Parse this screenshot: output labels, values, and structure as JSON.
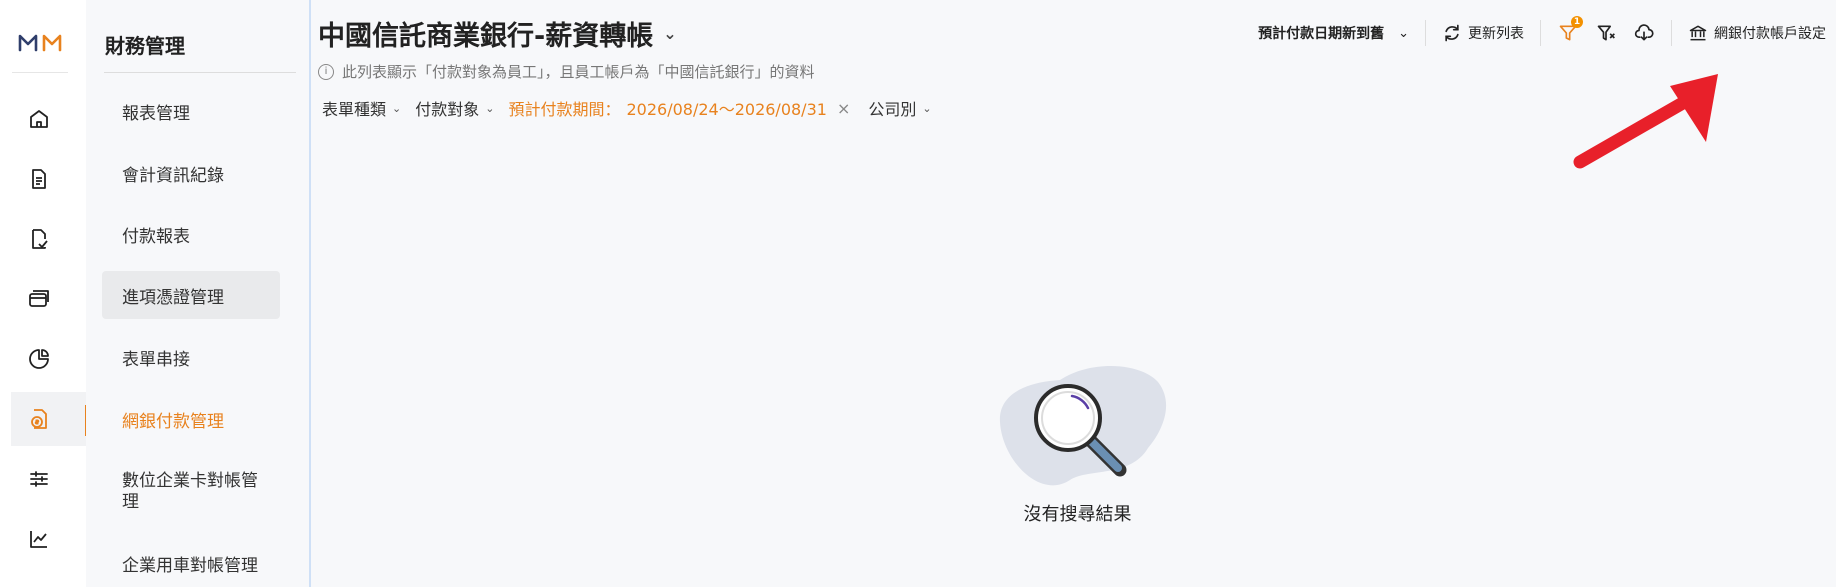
{
  "rail": {
    "items": [
      {
        "icon": "home-icon"
      },
      {
        "icon": "document-icon"
      },
      {
        "icon": "document-check-icon"
      },
      {
        "icon": "credit-card-icon"
      },
      {
        "icon": "pie-chart-icon"
      },
      {
        "icon": "payment-document-icon",
        "active": true
      },
      {
        "icon": "sliders-icon"
      },
      {
        "icon": "line-chart-icon"
      }
    ]
  },
  "submenu": {
    "title": "財務管理",
    "items": [
      {
        "label": "報表管理"
      },
      {
        "label": "會計資訊紀錄"
      },
      {
        "label": "付款報表"
      },
      {
        "label": "進項憑證管理",
        "selected": true
      },
      {
        "label": "表單串接"
      },
      {
        "label": "網銀付款管理",
        "active": true
      },
      {
        "label": "數位企業卡對帳管理"
      },
      {
        "label": "企業用車對帳管理"
      }
    ]
  },
  "header": {
    "title": "中國信託商業銀行-薪資轉帳",
    "info": "此列表顯示「付款對象為員工」，且員工帳戶為「中國信託銀行」的資料"
  },
  "filters": {
    "form_type": "表單種類",
    "payee": "付款對象",
    "period_label": "預計付款期間：",
    "period_value": "2026/08/24〜2026/08/31",
    "company": "公司別"
  },
  "toolbar": {
    "sort": "預計付款日期新到舊",
    "refresh": "更新列表",
    "filter_badge": "1",
    "bank_settings": "網銀付款帳戶設定"
  },
  "empty": {
    "text": "沒有搜尋結果"
  },
  "colors": {
    "accent": "#e8821e",
    "arrow": "#e8202a"
  }
}
